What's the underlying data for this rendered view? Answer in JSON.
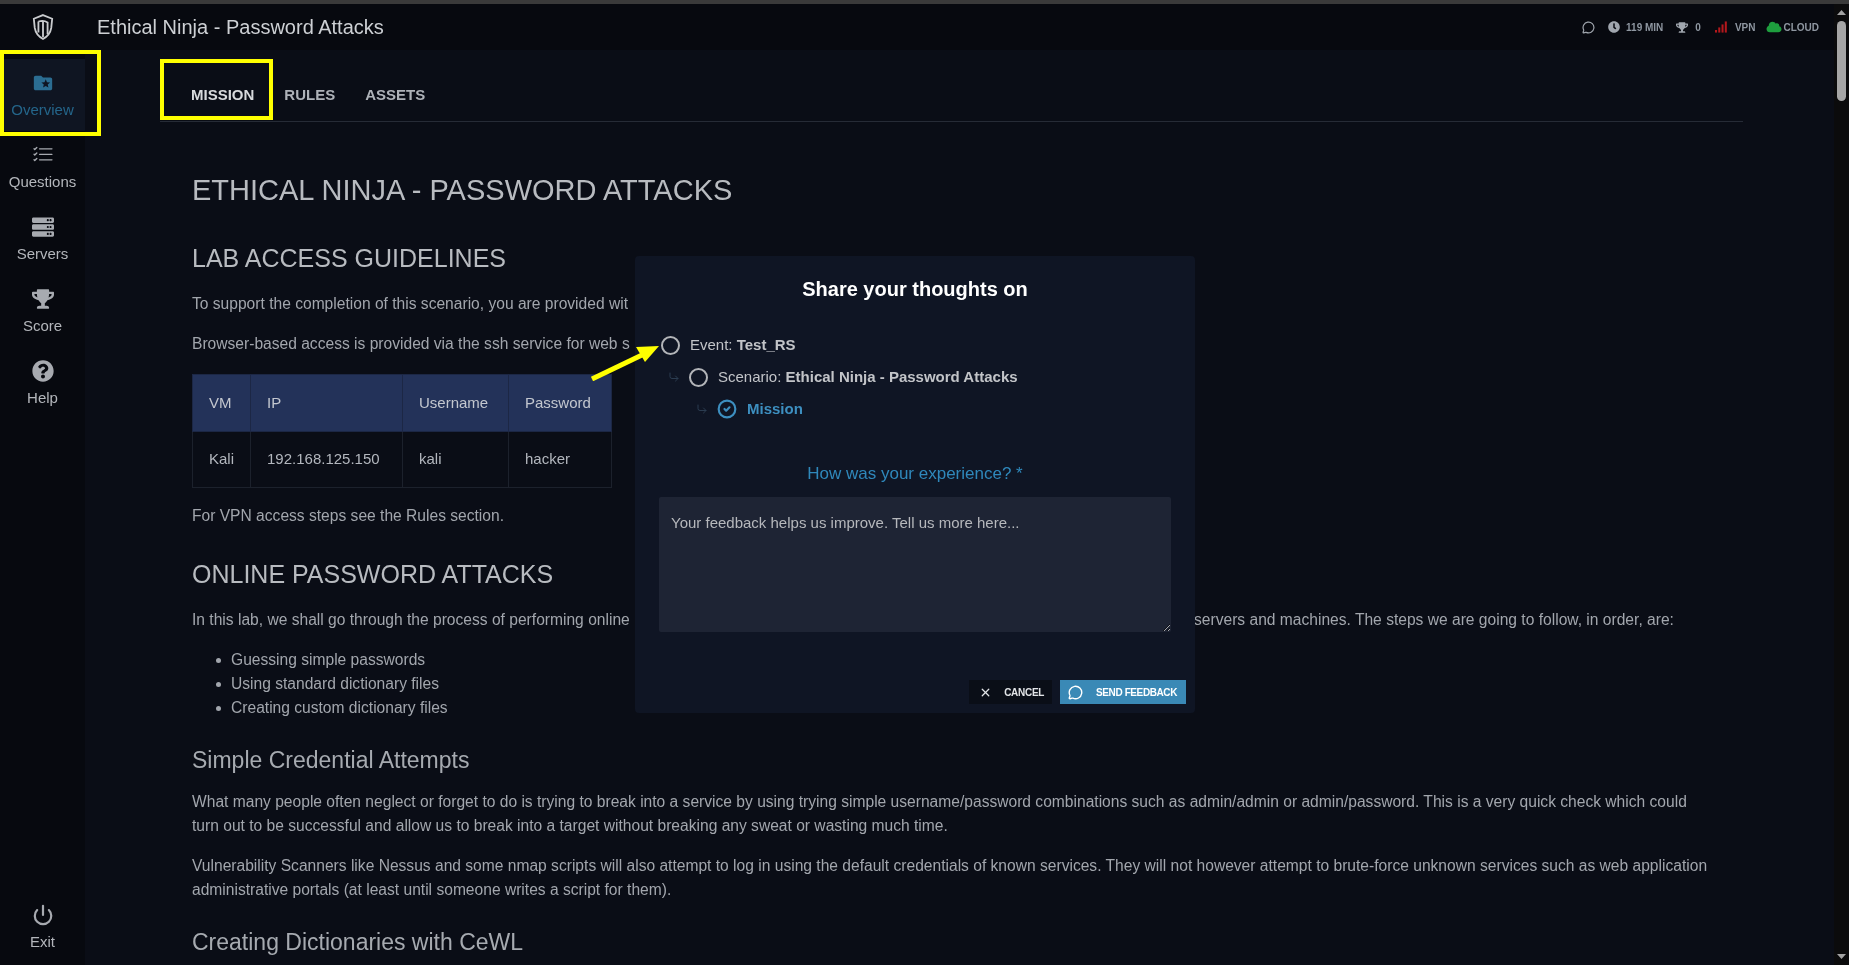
{
  "app": {
    "title": "Ethical Ninja - Password Attacks"
  },
  "status": [
    {
      "kind": "feedback"
    },
    {
      "kind": "timer",
      "text": "119 MIN"
    },
    {
      "kind": "score",
      "text": "0"
    },
    {
      "kind": "vpn",
      "text": "VPN",
      "color": "#b3181c"
    },
    {
      "kind": "cloud",
      "text": "CLOUD",
      "color": "#1e9e3e"
    }
  ],
  "sidebar": {
    "items": [
      {
        "kind": "overview",
        "label": "Overview",
        "selected": true,
        "highlighted": true
      },
      {
        "kind": "questions",
        "label": "Questions",
        "selected": false,
        "highlighted": false
      },
      {
        "kind": "servers",
        "label": "Servers",
        "selected": false,
        "highlighted": false
      },
      {
        "kind": "score",
        "label": "Score",
        "selected": false,
        "highlighted": false
      },
      {
        "kind": "help",
        "label": "Help",
        "selected": false,
        "highlighted": false
      }
    ],
    "exit": {
      "label": "Exit"
    }
  },
  "tabs": [
    {
      "label": "MISSION",
      "selected": true,
      "highlighted": true
    },
    {
      "label": "RULES",
      "selected": false,
      "highlighted": false
    },
    {
      "label": "ASSETS",
      "selected": false,
      "highlighted": false
    }
  ],
  "content": [
    {
      "kind": "title",
      "text": "ETHICAL NINJA - PASSWORD ATTACKS"
    },
    {
      "kind": "heading",
      "text": "LAB ACCESS GUIDELINES"
    },
    {
      "kind": "paragraph",
      "parts": [
        "To support the completion of this scenario, you are provided wit"
      ]
    },
    {
      "kind": "paragraph",
      "parts": [
        "Browser-based access is provided via the ssh service for web s"
      ]
    },
    {
      "kind": "table",
      "columns": [
        "VM",
        "IP",
        "Username",
        "Password"
      ],
      "rows": [
        [
          "Kali",
          "192.168.125.150",
          "kali",
          "hacker"
        ]
      ]
    },
    {
      "kind": "paragraph",
      "parts": [
        "For VPN access steps see the Rules section."
      ]
    },
    {
      "kind": "heading",
      "text": "ONLINE PASSWORD ATTACKS"
    },
    {
      "kind": "paragraph",
      "parts": [
        "In this lab, we shall go through the process of performing online",
        "servers and machines. The steps we are going to follow, in order, are:"
      ]
    },
    {
      "kind": "list",
      "items": [
        "Guessing simple passwords",
        "Using standard dictionary files",
        "Creating custom dictionary files"
      ]
    },
    {
      "kind": "subheading",
      "text": "Simple Credential Attempts"
    },
    {
      "kind": "paragraph",
      "parts": [
        "What many people often neglect or forget to do is trying to break into a service by using trying simple username/password combinations such as admin/admin or admin/password. This is a very quick check which could turn out to be successful and allow us to break into a target without breaking any sweat or wasting much time."
      ]
    },
    {
      "kind": "paragraph",
      "parts": [
        "Vulnerability Scanners like Nessus and some nmap scripts will also attempt to log in using the default credentials of known services. They will not however attempt to brute-force unknown services such as web application administrative portals (at least until someone writes a script for them)."
      ]
    },
    {
      "kind": "subheading",
      "text": "Creating Dictionaries with CeWL"
    }
  ],
  "feedback_dialog": {
    "title": "Share your thoughts on",
    "targets": [
      {
        "text": "Event: **Test_RS**",
        "selected": false,
        "pointed_at": true,
        "children": [
          {
            "text": "Scenario: **Ethical Ninja - Password Attacks**",
            "selected": false,
            "pointed_at": false,
            "children": [
              {
                "text": "Mission",
                "selected": true,
                "pointed_at": false
              }
            ]
          }
        ]
      }
    ],
    "question": "How was your experience? *",
    "placeholder": "Your feedback helps us improve. Tell us more here...",
    "buttons": [
      {
        "kind": "cancel",
        "label": "CANCEL"
      },
      {
        "kind": "send",
        "label": "SEND FEEDBACK"
      }
    ]
  }
}
